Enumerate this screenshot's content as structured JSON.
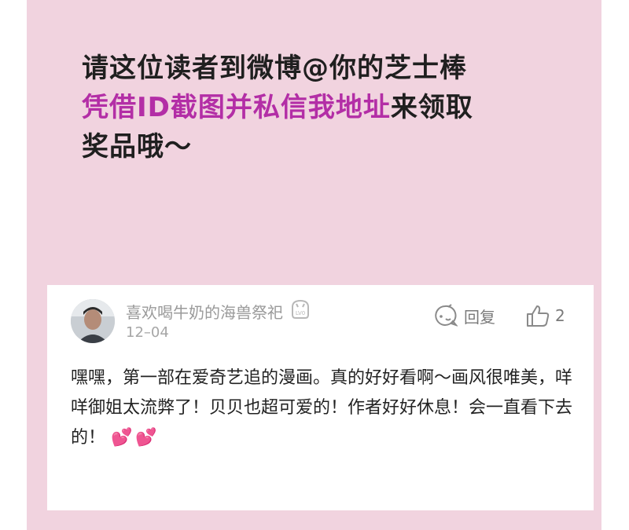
{
  "announcement": {
    "line1": "请这位读者到微博@你的芝士棒",
    "line2_highlight": "凭借ID截图并私信我地址",
    "line2_rest": "来领取",
    "line3": "奖品哦～"
  },
  "comment": {
    "username": "喜欢喝牛奶的海兽祭祀",
    "level_badge": "LV0",
    "date": "12–04",
    "reply_label": "回复",
    "like_count": "2",
    "text": "嘿嘿，第一部在爱奇艺追的漫画。真的好好看啊～画风很唯美，咩咩御姐太流弊了！贝贝也超可爱的！作者好好休息！会一直看下去的！",
    "emoji": "💕💕"
  },
  "colors": {
    "panel_bg": "#f1d3df",
    "highlight": "#b32ea6",
    "text": "#1f1f1f",
    "muted": "#9a9a9a"
  }
}
